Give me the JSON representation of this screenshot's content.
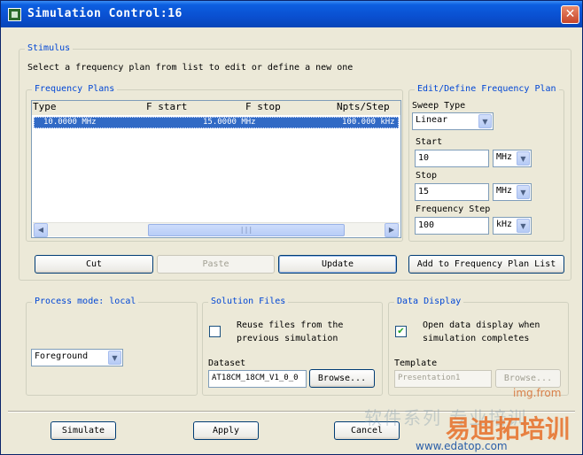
{
  "window": {
    "title": "Simulation Control:16",
    "close_glyph": "✕"
  },
  "stimulus": {
    "label": "Stimulus",
    "instruction": "Select a frequency plan from list to edit or define a new one"
  },
  "frequency_plans": {
    "label": "Frequency Plans",
    "columns": [
      "Type",
      "F start",
      "F stop",
      "Npts/Step"
    ],
    "rows": [
      {
        "type": "",
        "fstart": "10.0000 MHz",
        "fstop": "15.0000 MHz",
        "npts": "100.000 kHz",
        "selected": true
      }
    ],
    "scroll_left": "◀",
    "scroll_right": "▶",
    "scroll_grip": "|||"
  },
  "buttons": {
    "cut": "Cut",
    "paste": "Paste",
    "update": "Update",
    "add_to_list": "Add to Frequency Plan List",
    "simulate": "Simulate",
    "apply": "Apply",
    "cancel": "Cancel",
    "browse_dataset": "Browse...",
    "browse_template": "Browse..."
  },
  "edit_plan": {
    "label": "Edit/Define Frequency Plan",
    "sweep_type_label": "Sweep Type",
    "sweep_type": "Linear",
    "start_label": "Start",
    "start_value": "10",
    "start_unit": "MHz",
    "stop_label": "Stop",
    "stop_value": "15",
    "stop_unit": "MHz",
    "step_label": "Frequency Step",
    "step_value": "100",
    "step_unit": "kHz"
  },
  "process_mode": {
    "label": "Process mode: local",
    "mode": "Foreground"
  },
  "solution_files": {
    "label": "Solution Files",
    "reuse_text_1": "Reuse files from the",
    "reuse_text_2": "previous simulation",
    "reuse_checked": false,
    "dataset_label": "Dataset",
    "dataset_value": "AT18CM_18CM_V1_0_0"
  },
  "data_display": {
    "label": "Data Display",
    "open_text_1": "Open data display when",
    "open_text_2": "simulation completes",
    "open_checked": true,
    "check_glyph": "✔",
    "template_label": "Template",
    "template_value": "Presentation1"
  },
  "icons": {
    "dropdown": "▼"
  },
  "watermark": {
    "source": "img.from",
    "brand": "易迪拓培训",
    "site": "www.edatop.com",
    "tagline": "软件系列 专业培训"
  }
}
